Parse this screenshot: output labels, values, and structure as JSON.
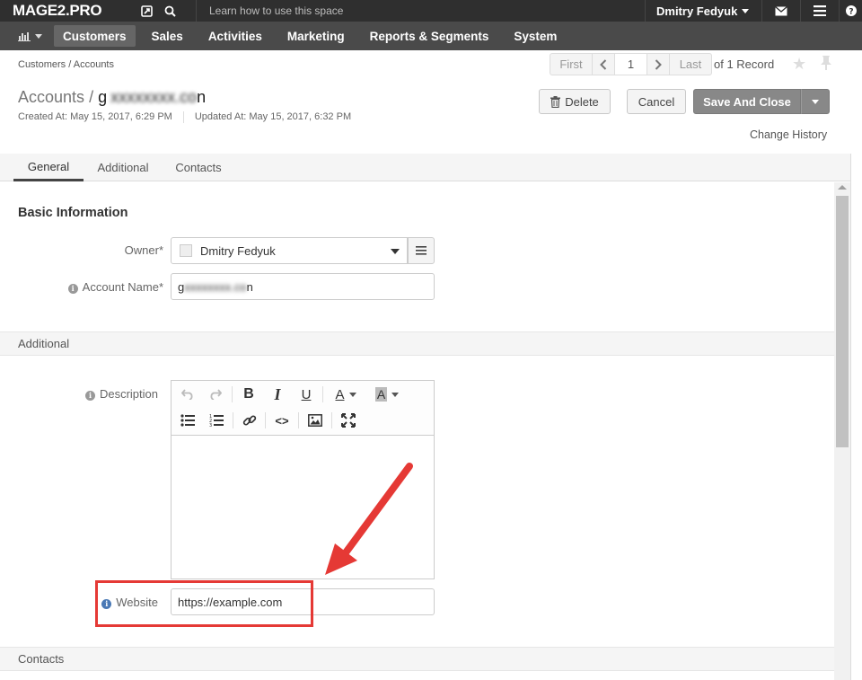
{
  "topbar": {
    "logo": "MAGE2.PRO",
    "search_placeholder": "Learn how to use this space",
    "user_name": "Dmitry Fedyuk"
  },
  "nav": {
    "items": [
      "Customers",
      "Sales",
      "Activities",
      "Marketing",
      "Reports & Segments",
      "System"
    ],
    "active_index": 0
  },
  "breadcrumb": "Customers / Accounts",
  "pager": {
    "first": "First",
    "page": "1",
    "last": "Last",
    "of_record": "of 1 Record"
  },
  "title": {
    "section": "Accounts",
    "separator": "/",
    "entity_start": "g",
    "entity_blurred": "xxxxxxxx.co",
    "entity_end": "n",
    "created": "Created At: May 15, 2017, 6:29 PM",
    "updated": "Updated At: May 15, 2017, 6:32 PM"
  },
  "actions": {
    "delete": "Delete",
    "cancel": "Cancel",
    "save_and_close": "Save And Close",
    "change_history": "Change History"
  },
  "tabs": [
    "General",
    "Additional",
    "Contacts"
  ],
  "form": {
    "basic_heading": "Basic Information",
    "owner_label": "Owner",
    "required_mark": "*",
    "owner_value": "Dmitry Fedyuk",
    "account_name_label": "Account Name",
    "account_name_start": "g",
    "account_name_blurred": "xxxxxxxx.co",
    "account_name_end": "n",
    "additional_heading": "Additional",
    "description_label": "Description",
    "website_label": "Website",
    "website_value": "https://example.com",
    "contacts_heading": "Contacts"
  },
  "editor_toolbar": [
    "undo-icon",
    "redo-icon",
    "bold-icon",
    "italic-icon",
    "underline-icon",
    "text-color-icon",
    "background-color-icon",
    "bullet-list-icon",
    "numbered-list-icon",
    "link-icon",
    "code-icon",
    "image-icon",
    "fullscreen-icon"
  ],
  "colors": {
    "topbar": "#2f2f2f",
    "nav": "#4a4a4a",
    "highlight": "#e53935",
    "save_button": "#888888"
  }
}
